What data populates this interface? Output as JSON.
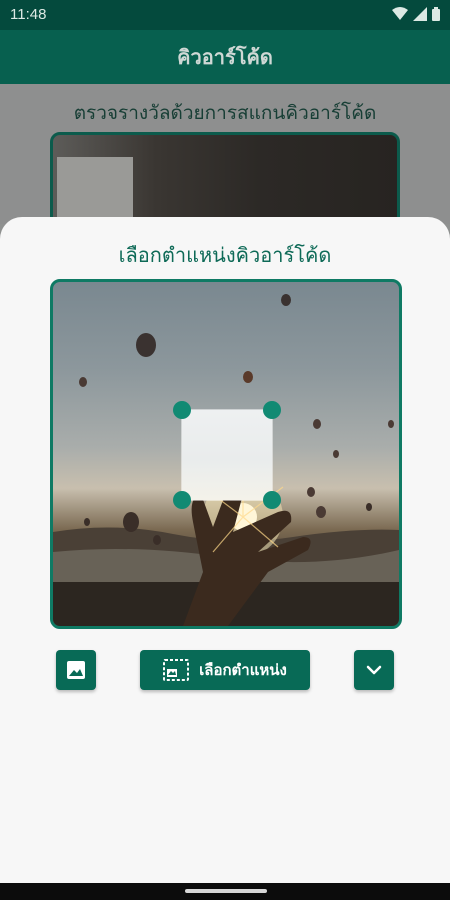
{
  "status_bar": {
    "time": "11:48"
  },
  "app_bar": {
    "title": "คิวอาร์โค้ด"
  },
  "background": {
    "heading": "ตรวจรางวัลด้วยการสแกนคิวอาร์โค้ด"
  },
  "sheet": {
    "title": "เลือกตำแหน่งคิวอาร์โค้ด",
    "select_button_label": "เลือกตำแหน่ง"
  },
  "icons": {
    "gallery": "image-icon",
    "select_region": "select-region-icon",
    "expand": "chevron-down-icon"
  },
  "colors": {
    "primary": "#07604f",
    "accent": "#118a73",
    "status_bar": "#044a3d"
  }
}
